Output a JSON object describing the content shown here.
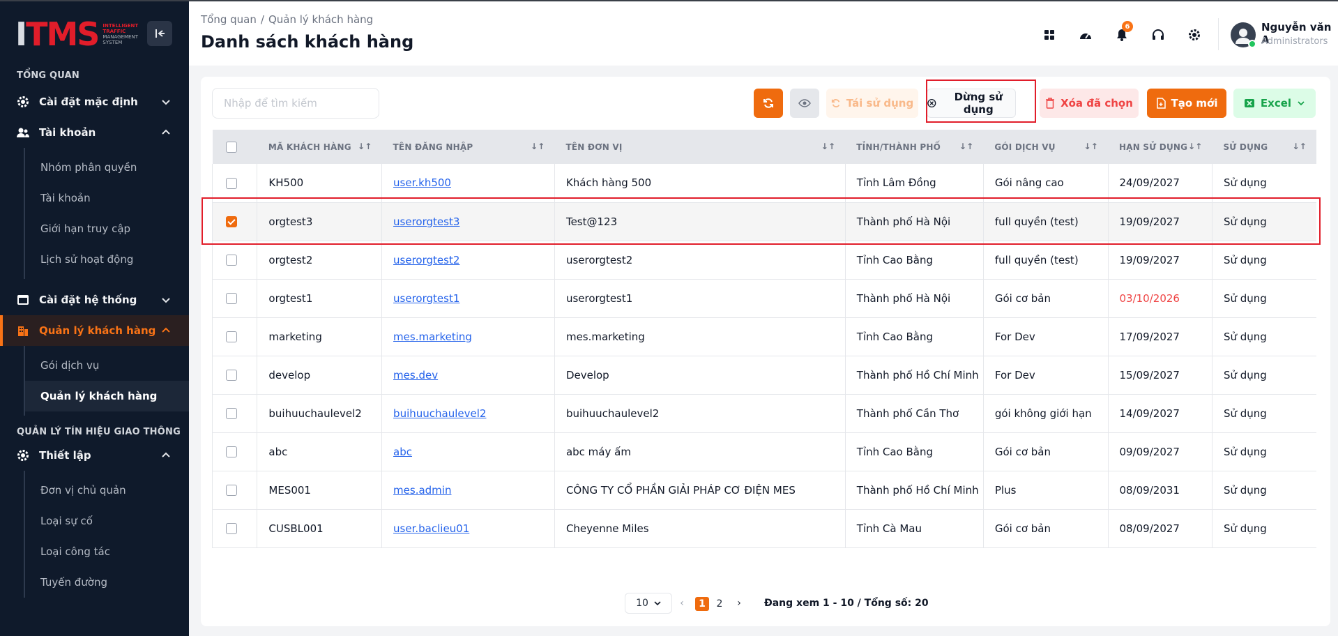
{
  "app": {
    "logo_main": "ITMS",
    "logo_line1": "INTELLIGENT",
    "logo_line2": "TRAFFIC",
    "logo_line3": "MANAGEMENT",
    "logo_line4": "SYSTEM"
  },
  "sidebar": {
    "section_overview": "TỔNG QUAN",
    "section_traffic": "QUẢN LÝ TÍN HIỆU GIAO THÔNG",
    "menu": {
      "default_settings": "Cài đặt mặc định",
      "accounts": "Tài khoản",
      "system_settings": "Cài đặt hệ thống",
      "customer_mgmt": "Quản lý khách hàng",
      "setup": "Thiết lập"
    },
    "accounts_sub": [
      "Nhóm phân quyền",
      "Tài khoản",
      "Giới hạn truy cập",
      "Lịch sử hoạt động"
    ],
    "customer_sub": [
      "Gói dịch vụ",
      "Quản lý khách hàng"
    ],
    "setup_sub": [
      "Đơn vị chủ quản",
      "Loại sự cố",
      "Loại công tác",
      "Tuyến đường"
    ]
  },
  "header": {
    "breadcrumb_home": "Tổng quan",
    "breadcrumb_current": "Quản lý khách hàng",
    "title": "Danh sách khách hàng",
    "notif_count": "6",
    "user_name": "Nguyễn văn A",
    "user_role": "Administrators"
  },
  "toolbar": {
    "search_placeholder": "Nhập để tìm kiếm",
    "reuse": "Tái sử dụng",
    "stop": "Dừng sử dụng",
    "delete": "Xóa đã chọn",
    "create": "Tạo mới",
    "excel": "Excel"
  },
  "table": {
    "columns": [
      "MÃ KHÁCH HÀNG",
      "TÊN ĐĂNG NHẬP",
      "TÊN ĐƠN VỊ",
      "TỈNH/THÀNH PHỐ",
      "GÓI DỊCH VỤ",
      "HẠN SỬ DỤNG",
      "SỬ DỤNG"
    ],
    "rows": [
      {
        "code": "KH500",
        "username": "user.kh500",
        "unit": "Khách hàng 500",
        "province": "Tỉnh Lâm Đồng",
        "package": "Gói nâng cao",
        "expiry": "24/09/2027",
        "status": "Sử dụng",
        "checked": false,
        "expired_soon": false
      },
      {
        "code": "orgtest3",
        "username": "userorgtest3",
        "unit": "Test@123",
        "province": "Thành phố Hà Nội",
        "package": "full quyền (test)",
        "expiry": "19/09/2027",
        "status": "Sử dụng",
        "checked": true,
        "expired_soon": false
      },
      {
        "code": "orgtest2",
        "username": "userorgtest2",
        "unit": "userorgtest2",
        "province": "Tỉnh Cao Bằng",
        "package": "full quyền (test)",
        "expiry": "19/09/2027",
        "status": "Sử dụng",
        "checked": false,
        "expired_soon": false
      },
      {
        "code": "orgtest1",
        "username": "userorgtest1",
        "unit": "userorgtest1",
        "province": "Thành phố Hà Nội",
        "package": "Gói cơ bản",
        "expiry": "03/10/2026",
        "status": "Sử dụng",
        "checked": false,
        "expired_soon": true
      },
      {
        "code": "marketing",
        "username": "mes.marketing",
        "unit": "mes.marketing",
        "province": "Tỉnh Cao Bằng",
        "package": "For Dev",
        "expiry": "17/09/2027",
        "status": "Sử dụng",
        "checked": false,
        "expired_soon": false
      },
      {
        "code": "develop",
        "username": "mes.dev",
        "unit": "Develop",
        "province": "Thành phố Hồ Chí Minh",
        "package": "For Dev",
        "expiry": "15/09/2027",
        "status": "Sử dụng",
        "checked": false,
        "expired_soon": false
      },
      {
        "code": "buihuuchaulevel2",
        "username": "buihuuchaulevel2",
        "unit": "buihuuchaulevel2",
        "province": "Thành phố Cần Thơ",
        "package": "gói không giới hạn",
        "expiry": "14/09/2027",
        "status": "Sử dụng",
        "checked": false,
        "expired_soon": false
      },
      {
        "code": "abc",
        "username": "abc",
        "unit": "abc máy ấm",
        "province": "Tỉnh Cao Bằng",
        "package": "Gói cơ bản",
        "expiry": "09/09/2027",
        "status": "Sử dụng",
        "checked": false,
        "expired_soon": false
      },
      {
        "code": "MES001",
        "username": "mes.admin",
        "unit": "CÔNG TY CỔ PHẦN GIẢI PHÁP CƠ ĐIỆN MES",
        "province": "Thành phố Hồ Chí Minh",
        "package": "Plus",
        "expiry": "08/09/2031",
        "status": "Sử dụng",
        "checked": false,
        "expired_soon": false
      },
      {
        "code": "CUSBL001",
        "username": "user.baclieu01",
        "unit": "Cheyenne Miles",
        "province": "Tỉnh Cà Mau",
        "package": "Gói cơ bản",
        "expiry": "08/09/2027",
        "status": "Sử dụng",
        "checked": false,
        "expired_soon": false
      }
    ]
  },
  "pagination": {
    "page_size": "10",
    "pages": [
      "1",
      "2"
    ],
    "current": "1",
    "info": "Đang xem 1 - 10 / Tổng số: 20"
  },
  "colors": {
    "accent": "#ef6b0e",
    "sidebar_bg": "#0f1a2b",
    "highlight": "#e11d2a"
  }
}
